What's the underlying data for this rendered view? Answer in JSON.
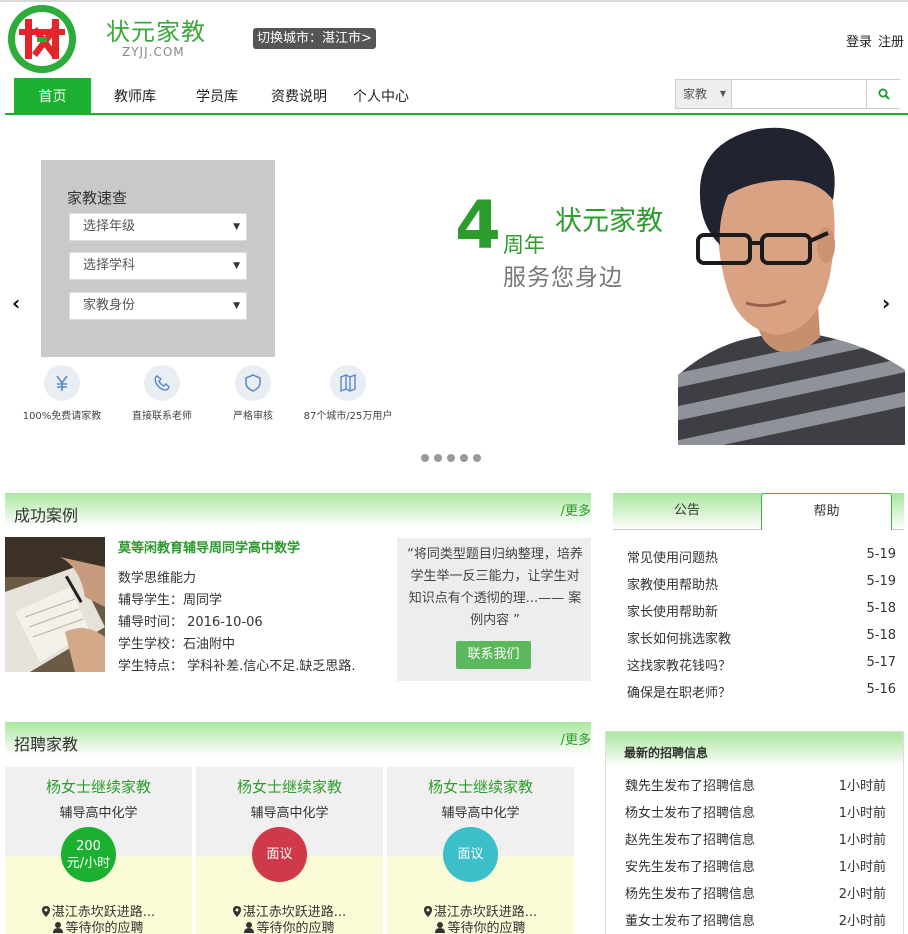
{
  "header": {
    "logo_text": "状",
    "brand_name": "状元家教",
    "brand_domain": "ZYJJ.COM",
    "city_switch": "切换城市：湛江市>",
    "login": "登录",
    "register": "注册"
  },
  "nav": {
    "items": [
      "首页",
      "教师库",
      "学员库",
      "资费说明",
      "个人中心"
    ],
    "active": "首页"
  },
  "search": {
    "category": "家教",
    "value": "",
    "placeholder": "",
    "icon": "search-icon"
  },
  "banner": {
    "quick_title": "家教速查",
    "selects": [
      "选择年级",
      "选择学科",
      "家教身份"
    ],
    "features": [
      {
        "icon": "yen-icon",
        "label": "100%免费请家教"
      },
      {
        "icon": "phone-icon",
        "label": "直接联系老师"
      },
      {
        "icon": "shield-icon",
        "label": "严格审核"
      },
      {
        "icon": "map-icon",
        "label": "87个城市/25万用户"
      }
    ],
    "slogan_number": "4",
    "slogan_years": "周年",
    "slogan_brand": "状元家教",
    "slogan_service": "服务您身边",
    "dots_count": 5
  },
  "success": {
    "title": "成功案例",
    "more": "/更多",
    "case_title": "莫等闲教育辅导周同学高中数学",
    "lines": [
      "数学思维能力",
      "辅导学生：周同学",
      "辅导时间：  2016-10-06",
      "学生学校：石油附中",
      "学生特点：  学科补差.信心不足.缺乏思路."
    ],
    "quote": "“将同类型题目归纳整理，培养学生举一反三能力，让学生对知识点有个透彻的理...—— 案例内容 ”",
    "contact": "联系我们"
  },
  "notice": {
    "tabs": [
      "公告",
      "帮助"
    ],
    "items": [
      {
        "title": "常见使用问题热",
        "date": "5-19"
      },
      {
        "title": "家教使用帮助热",
        "date": "5-19"
      },
      {
        "title": "家长使用帮助新",
        "date": "5-18"
      },
      {
        "title": "家长如何挑选家教",
        "date": "5-18"
      },
      {
        "title": "这找家教花钱吗？",
        "date": "5-17"
      },
      {
        "title": "确保是在职老师？",
        "date": "5-16"
      }
    ]
  },
  "recruit": {
    "title": "招聘家教",
    "more": "/更多",
    "cards": [
      {
        "name": "杨女士继续家教",
        "subject": "辅导高中化学",
        "price_line1": "200",
        "price_line2": "元/小时",
        "color": "#1bb02f",
        "location": "湛江赤坎跃进路...",
        "status": "等待你的应聘"
      },
      {
        "name": "杨女士继续家教",
        "subject": "辅导高中化学",
        "price_line1": "面议",
        "price_line2": "",
        "color": "#d0394a",
        "location": "湛江赤坎跃进路...",
        "status": "等待你的应聘"
      },
      {
        "name": "杨女士继续家教",
        "subject": "辅导高中化学",
        "price_line1": "面议",
        "price_line2": "",
        "color": "#3bbfc9",
        "location": "湛江赤坎跃进路...",
        "status": "等待你的应聘"
      }
    ]
  },
  "latest": {
    "title": "最新的招聘信息",
    "items": [
      {
        "text": "魏先生发布了招聘信息",
        "time": "1小时前"
      },
      {
        "text": "杨女士发布了招聘信息",
        "time": "1小时前"
      },
      {
        "text": "赵先生发布了招聘信息",
        "time": "1小时前"
      },
      {
        "text": "安先生发布了招聘信息",
        "time": "1小时前"
      },
      {
        "text": "杨先生发布了招聘信息",
        "time": "2小时前"
      },
      {
        "text": "董女士发布了招聘信息",
        "time": "2小时前"
      }
    ]
  }
}
